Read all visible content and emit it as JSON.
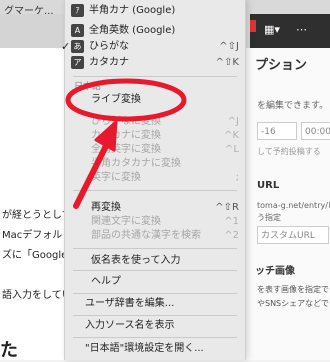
{
  "browser": {
    "bookmark_text": "グマーケ..."
  },
  "left_doc": {
    "lines": [
      "が経とうとして",
      "Macデフォルト",
      "ズに「Google日",
      "語入力をしてい"
    ],
    "glyph": "た"
  },
  "right_panel": {
    "title": "プション",
    "desc": "を編集できます。",
    "date_value": "-16",
    "time_value": "00:00",
    "schedule_hint": "して予約投稿する",
    "url_heading": "URL",
    "url_text": "toma-g.net/entry/以",
    "url_hint": "う指定",
    "custom_url_placeholder": "カスタムURL",
    "eyecatch_heading": "ッチ画像",
    "eyecatch_line1": "を表す画像を指定でき",
    "eyecatch_line2": "やSNSシェアなどで"
  },
  "menu": {
    "items_top": [
      {
        "label": "半角カナ (Google)",
        "icon": "ｱ",
        "shortcut": ""
      },
      {
        "label": "全角英数 (Google)",
        "icon": "A",
        "shortcut": ""
      },
      {
        "label": "ひらがな",
        "icon": "あ",
        "shortcut": "^⇧J",
        "checked": true
      },
      {
        "label": "カタカナ",
        "icon": "ア",
        "shortcut": "^⇧K"
      }
    ],
    "section_label": "日本語",
    "conv_items": [
      {
        "label": "ライブ変換",
        "shortcut": "",
        "disabled": false
      },
      {
        "label": "ひらがなに変換",
        "shortcut": "^J",
        "disabled": true
      },
      {
        "label": "カタカナに変換",
        "shortcut": "^K",
        "disabled": true
      },
      {
        "label": "全角英字に変換",
        "shortcut": "^L",
        "disabled": true
      },
      {
        "label": "半角カタカナに変換",
        "shortcut": "",
        "disabled": true
      },
      {
        "label": "英字に変換",
        "shortcut": ";",
        "disabled": true
      }
    ],
    "reconv_items": [
      {
        "label": "再変換",
        "shortcut": "^⇧R",
        "disabled": false
      },
      {
        "label": "関連文字に変換",
        "shortcut": "^1",
        "disabled": true
      },
      {
        "label": "部品の共通な漢字を検索",
        "shortcut": "^2",
        "disabled": true
      }
    ],
    "kana_table": "仮名表を使って入力",
    "help": "ヘルプ",
    "user_dict": "ユーザ辞書を編集...",
    "show_source": "入力ソース名を表示",
    "prefs": "\"日本語\"環境設定を開く..."
  },
  "colors": {
    "annotation": "#e8192c",
    "menu_bg": "#e9e9e9"
  }
}
